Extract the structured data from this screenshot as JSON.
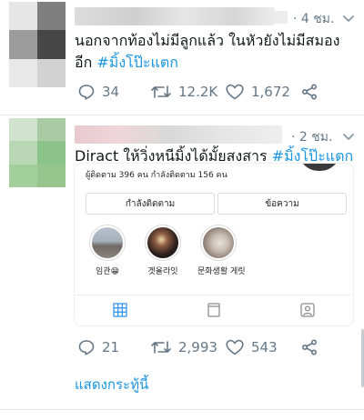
{
  "tweets": [
    {
      "time": "· 4 ชม.",
      "text_line1": "นอกจากท้องไม่มีลูกแล้ว ในหัวยังไม่มีสมอง",
      "text_line2_plain": "อีก ",
      "hashtag": "#มิ้งโป๊ะแตก",
      "replies": "34",
      "retweets": "12.2K",
      "likes": "1,672"
    },
    {
      "time": "· 2 ชม.",
      "text_plain": "Diract ให้วิ่งหนีมิ้งได้มั้ยสงสาร ",
      "hashtag": "#มิ้งโป๊ะแตก",
      "replies": "21",
      "retweets": "2,993",
      "likes": "543",
      "embedded_card": {
        "stats": "ผู้ติดตาม 396 คน   กำลังติดตาม 156 คน",
        "following_button": "กำลังติดตาม",
        "message_button": "ข้อความ",
        "highlights": [
          {
            "label": "임관😁"
          },
          {
            "label": "겟올라잇"
          },
          {
            "label": "문화생활 게릿"
          }
        ]
      }
    }
  ],
  "show_replies": "แสดงกระทู้นี้",
  "colors": {
    "link": "#1b95e0",
    "muted": "#657786",
    "divider": "#e1e8ed",
    "text": "#14171a"
  },
  "icons": [
    "chevron-down-icon",
    "reply-icon",
    "retweet-icon",
    "like-icon",
    "share-icon",
    "grid-icon",
    "igtv-icon",
    "tagged-icon"
  ]
}
